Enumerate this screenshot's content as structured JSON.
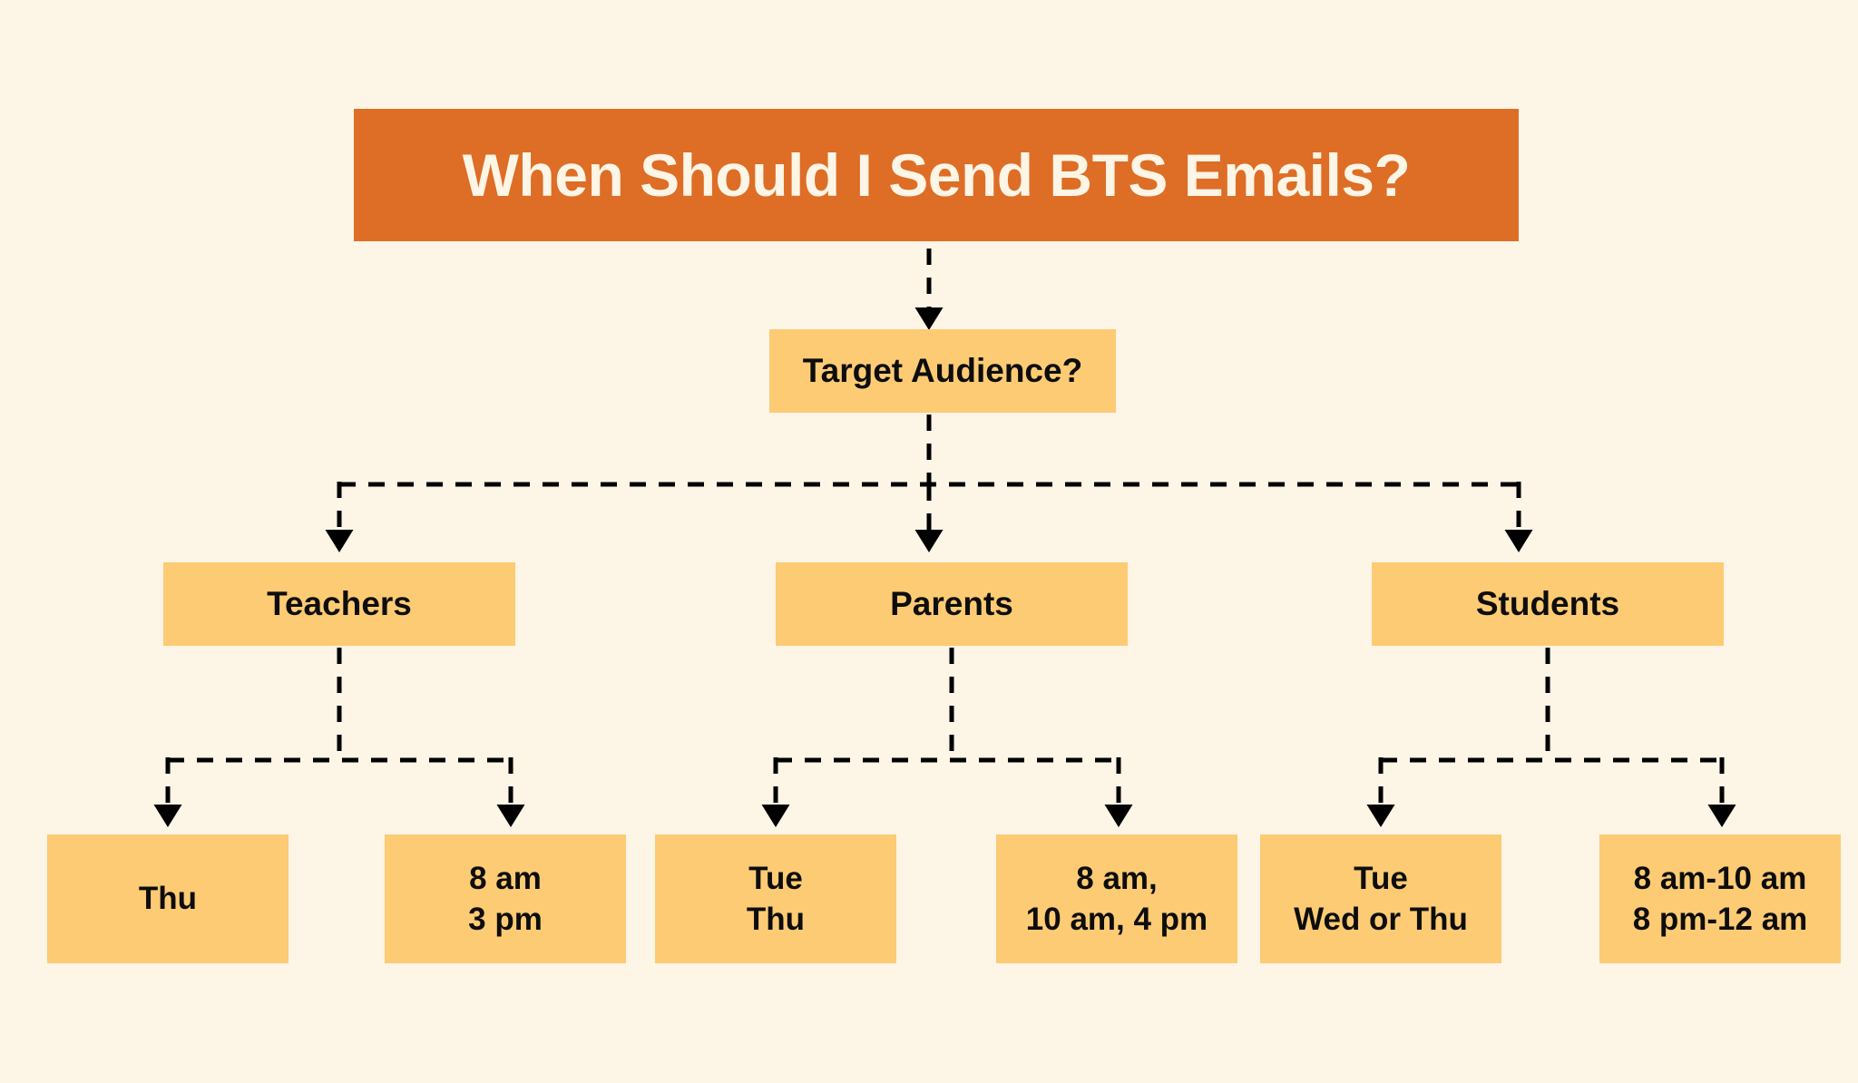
{
  "colors": {
    "background": "#FDF5E6",
    "banner": "#DE6D26",
    "banner_text": "#FDF5E6",
    "node_fill": "#FDCB74",
    "node_text": "#0D0D0D",
    "connector": "#000000"
  },
  "banner": {
    "title": "When Should I Send BTS Emails?"
  },
  "decision": {
    "label": "Target Audience?"
  },
  "audiences": [
    {
      "label": "Teachers"
    },
    {
      "label": "Parents"
    },
    {
      "label": "Students"
    }
  ],
  "leaves": {
    "teachers_day": {
      "line1": "Thu",
      "line2": ""
    },
    "teachers_time": {
      "line1": "8 am",
      "line2": "3 pm"
    },
    "parents_day": {
      "line1": "Tue",
      "line2": "Thu"
    },
    "parents_time": {
      "line1": "8 am,",
      "line2": "10 am, 4 pm"
    },
    "students_day": {
      "line1": "Tue",
      "line2": "Wed or Thu"
    },
    "students_time": {
      "line1": "8 am-10 am",
      "line2": "8 pm-12 am"
    }
  },
  "chart_data": {
    "type": "diagram",
    "title": "When Should I Send BTS Emails?",
    "root": "Target Audience?",
    "branches": [
      {
        "audience": "Teachers",
        "best_days": "Thu",
        "best_times": "8 am, 3 pm"
      },
      {
        "audience": "Parents",
        "best_days": "Tue, Thu",
        "best_times": "8 am, 10 am, 4 pm"
      },
      {
        "audience": "Students",
        "best_days": "Tue, Wed or Thu",
        "best_times": "8 am-10 am, 8 pm-12 am"
      }
    ],
    "connector_style": "dashed-elbow-with-arrowheads",
    "orientation": "top-down"
  }
}
